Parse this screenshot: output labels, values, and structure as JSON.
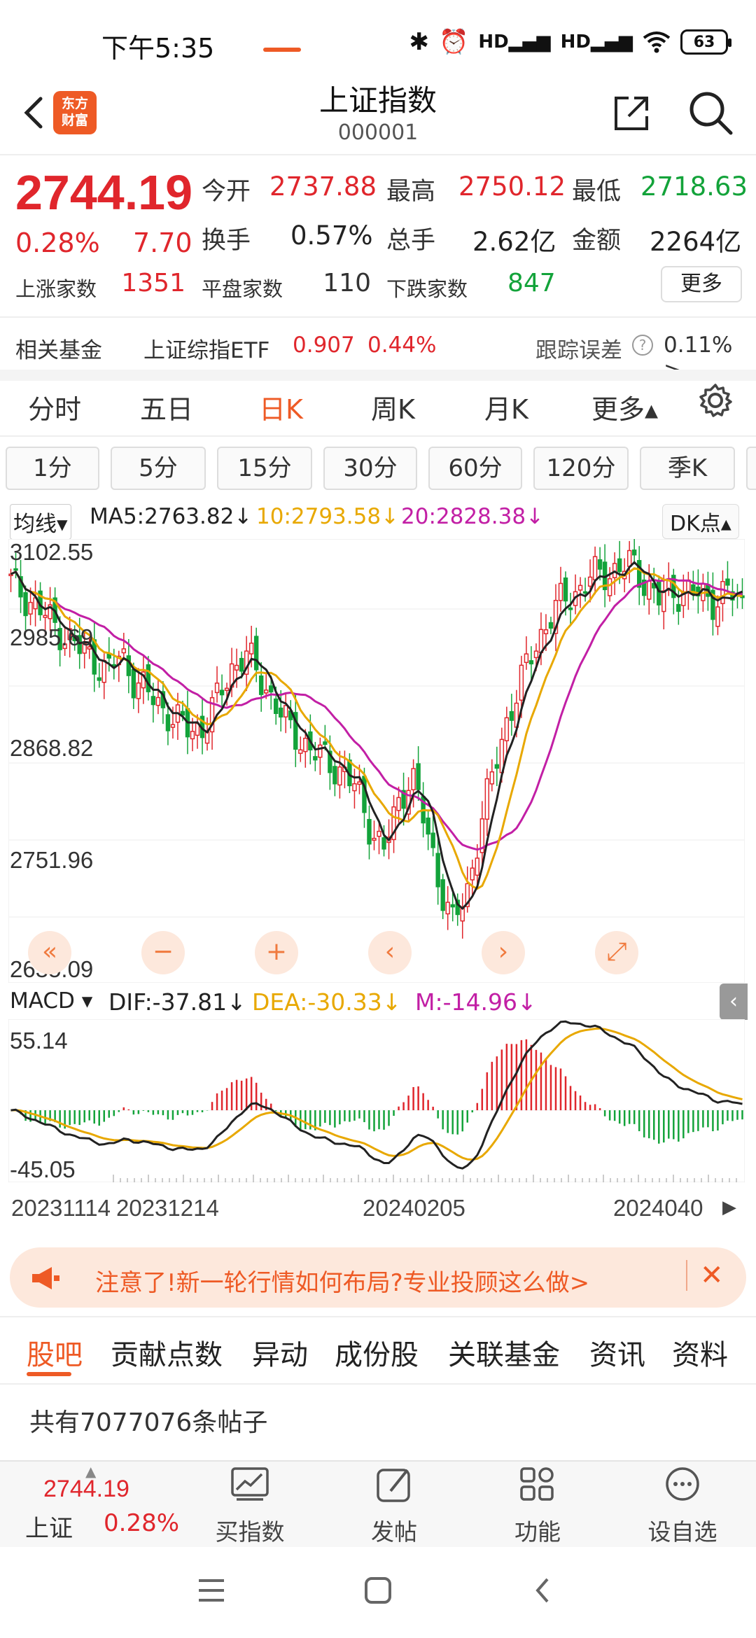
{
  "status": {
    "time": "下午5:35",
    "battery": "63"
  },
  "header": {
    "title": "上证指数",
    "code": "000001",
    "logo": "东方\n财富"
  },
  "quote": {
    "price": "2744.19",
    "change_pct": "0.28%",
    "change_amt": "7.70",
    "open_label": "今开",
    "open": "2737.88",
    "high_label": "最高",
    "high": "2750.12",
    "low_label": "最低",
    "low": "2718.63",
    "turnover_label": "换手",
    "turnover": "0.57%",
    "volume_label": "总手",
    "volume": "2.62亿",
    "amount_label": "金额",
    "amount": "2264亿",
    "advance_label": "上涨家数",
    "advance": "1351",
    "flat_label": "平盘家数",
    "flat": "110",
    "decline_label": "下跌家数",
    "decline": "847",
    "more_label": "更多"
  },
  "fund": {
    "label": "相关基金",
    "name": "上证综指ETF",
    "price": "0.907",
    "pct": "0.44%",
    "track_label": "跟踪误差",
    "track_value": "0.11% >"
  },
  "period_tabs": [
    "分时",
    "五日",
    "日K",
    "周K",
    "月K",
    "更多▴"
  ],
  "minute_tabs": [
    "1分",
    "5分",
    "15分",
    "30分",
    "60分",
    "120分",
    "季K"
  ],
  "ma_legend": {
    "select": "均线▾",
    "ma5": "MA5:2763.82↓",
    "ma10": "10:2793.58↓",
    "ma20": "20:2828.38↓",
    "dk": "DK点▴"
  },
  "kline_axis": [
    "3102.55",
    "2985.69",
    "2868.82",
    "2751.96",
    "2635.09"
  ],
  "macd_legend": {
    "select": "MACD ▾",
    "dif": "DIF:-37.81↓",
    "dea": "DEA:-30.33↓",
    "m": "M:-14.96↓"
  },
  "macd_axis": [
    "55.14",
    "-45.05"
  ],
  "x_axis": [
    "20231114",
    "20231214",
    "20240205",
    "2024040"
  ],
  "chart_controls": [
    "«",
    "−",
    "+",
    "‹",
    "›",
    "⤢"
  ],
  "colors": {
    "up": "#e0262c",
    "down": "#13a33a",
    "accent": "#ee5a25",
    "ma5": "#222222",
    "ma10": "#e8a800",
    "ma20": "#c21fa5"
  },
  "chart_data": {
    "type": "candlestick",
    "y_range": [
      2635.09,
      3102.55
    ],
    "series_anchor": [
      3070,
      3055,
      3040,
      3025,
      3010,
      2995,
      2985,
      2970,
      2990,
      2960,
      2945,
      2930,
      2915,
      2905,
      2910,
      2940,
      2975,
      2990,
      2965,
      2940,
      2910,
      2895,
      2880,
      2870,
      2860,
      2840,
      2800,
      2770,
      2820,
      2860,
      2800,
      2740,
      2690,
      2720,
      2800,
      2860,
      2920,
      2960,
      3000,
      3030,
      3050,
      3060,
      3075,
      3080,
      3085,
      3090,
      3070,
      3050,
      3060,
      3060,
      3055,
      3050,
      3060,
      3045
    ],
    "macd_range": [
      -45.05,
      55.14
    ]
  },
  "banner": {
    "text": "注意了!新一轮行情如何布局?专业投顾这么做>",
    "close": "✕"
  },
  "bottom_tabs": [
    "股吧",
    "贡献点数",
    "异动",
    "成份股",
    "关联基金",
    "资讯",
    "资料"
  ],
  "post_count": "共有7077076条帖子",
  "toolbar": {
    "price": "2744.19",
    "name": "上证",
    "pct": "0.28%",
    "buy": "买指数",
    "post": "发帖",
    "func": "功能",
    "watch": "设自选"
  }
}
